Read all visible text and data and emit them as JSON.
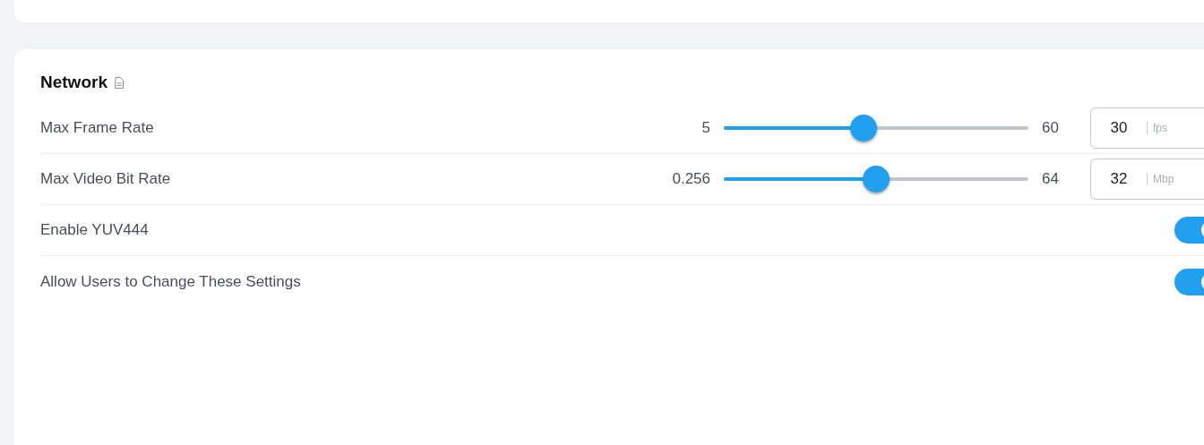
{
  "section": {
    "title": "Network"
  },
  "settings": [
    {
      "kind": "slider",
      "label": "Max Frame Rate",
      "min": "5",
      "max": "60",
      "level": 0.46,
      "value": "30",
      "unit": "fps"
    },
    {
      "kind": "slider",
      "label": "Max Video Bit Rate",
      "min": "0.256",
      "max": "64",
      "level": 0.5,
      "value": "32",
      "unit": "Mbp"
    },
    {
      "kind": "toggle",
      "label": "Enable YUV444",
      "on": true
    },
    {
      "kind": "toggle",
      "label": "Allow Users to Change These Settings",
      "on": true
    }
  ]
}
